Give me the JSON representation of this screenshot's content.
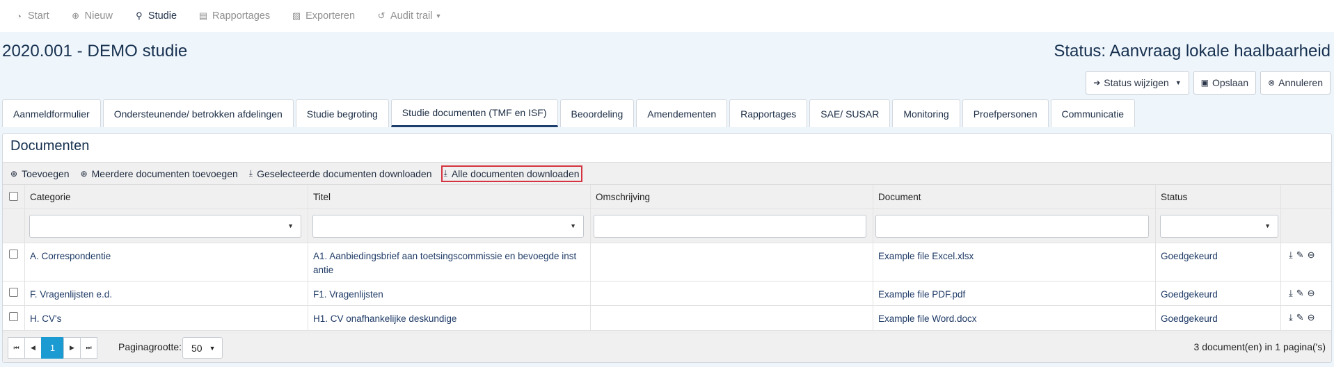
{
  "nav": {
    "items": [
      {
        "label": "Start",
        "icon": "dashboard-icon",
        "glyph": "◔"
      },
      {
        "label": "Nieuw",
        "icon": "zoom-in-icon",
        "glyph": "⊕"
      },
      {
        "label": "Studie",
        "icon": "search-icon",
        "glyph": "⚲"
      },
      {
        "label": "Rapportages",
        "icon": "report-icon",
        "glyph": "▤"
      },
      {
        "label": "Exporteren",
        "icon": "export-icon",
        "glyph": "▧"
      },
      {
        "label": "Audit trail",
        "icon": "history-icon",
        "glyph": "↺"
      }
    ],
    "active": "Studie"
  },
  "study": {
    "title": "2020.001 - DEMO studie",
    "status": "Status: Aanvraag lokale haalbaarheid"
  },
  "actions": {
    "status_change": "Status wijzigen",
    "save": "Opslaan",
    "cancel": "Annuleren"
  },
  "tabs": [
    "Aanmeldformulier",
    "Ondersteunende/ betrokken afdelingen",
    "Studie begroting",
    "Studie documenten (TMF en ISF)",
    "Beoordeling",
    "Amendementen",
    "Rapportages",
    "SAE/ SUSAR",
    "Monitoring",
    "Proefpersonen",
    "Communicatie"
  ],
  "active_tab": "Studie documenten (TMF en ISF)",
  "panel": {
    "title": "Documenten",
    "toolbar": {
      "add": "Toevoegen",
      "add_multiple": "Meerdere documenten toevoegen",
      "download_selected": "Geselecteerde documenten downloaden",
      "download_all": "Alle documenten downloaden"
    },
    "columns": [
      "Categorie",
      "Titel",
      "Omschrijving",
      "Document",
      "Status"
    ],
    "rows": [
      {
        "categorie": "A. Correspondentie",
        "titel": "A1. Aanbiedingsbrief aan toetsingscommissie en bevoegde inst antie",
        "omschrijving": "",
        "document": "Example file Excel.xlsx",
        "status": "Goedgekeurd"
      },
      {
        "categorie": "F. Vragenlijsten e.d.",
        "titel": "F1. Vragenlijsten",
        "omschrijving": "",
        "document": "Example file PDF.pdf",
        "status": "Goedgekeurd"
      },
      {
        "categorie": "H. CV's",
        "titel": "H1. CV onafhankelijke deskundige",
        "omschrijving": "",
        "document": "Example file Word.docx",
        "status": "Goedgekeurd"
      }
    ],
    "pager": {
      "current_page": "1",
      "page_size_label": "Paginagrootte:",
      "page_size": "50",
      "info": "3 document(en) in 1 pagina('s)"
    }
  },
  "colors": {
    "accent": "#1b9bd1",
    "title": "#16304f",
    "highlight": "#d3343f",
    "background": "#eef5fb"
  }
}
